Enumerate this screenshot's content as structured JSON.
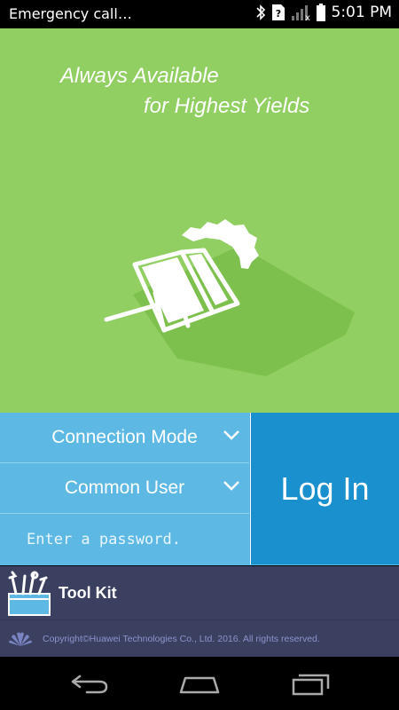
{
  "status_bar": {
    "left_text": "Emergency call…",
    "time": "5:01 PM",
    "icons": [
      "bluetooth-icon",
      "sim-unknown-icon",
      "signal-no-service-icon",
      "battery-icon"
    ]
  },
  "hero": {
    "slogan_line1": "Always Available",
    "slogan_line2": "for Highest Yields",
    "background_color": "#92cf62",
    "graphic": "solar-panel-sun-icon"
  },
  "login_form": {
    "connection_mode": "Connection Mode",
    "user_type": "Common User",
    "password_placeholder": "Enter a password.",
    "login_label": "Log In",
    "panel_color": "#5db8e4",
    "button_color": "#1b90ce"
  },
  "toolkit": {
    "label": "Tool Kit",
    "icon": "toolbox-icon"
  },
  "footer": {
    "copyright": "Copyright©Huawei Technologies Co., Ltd. 2016. All rights reserved.",
    "logo": "huawei-logo-icon"
  },
  "nav_bar": {
    "buttons": [
      "back-icon",
      "home-icon",
      "recent-apps-icon"
    ]
  }
}
